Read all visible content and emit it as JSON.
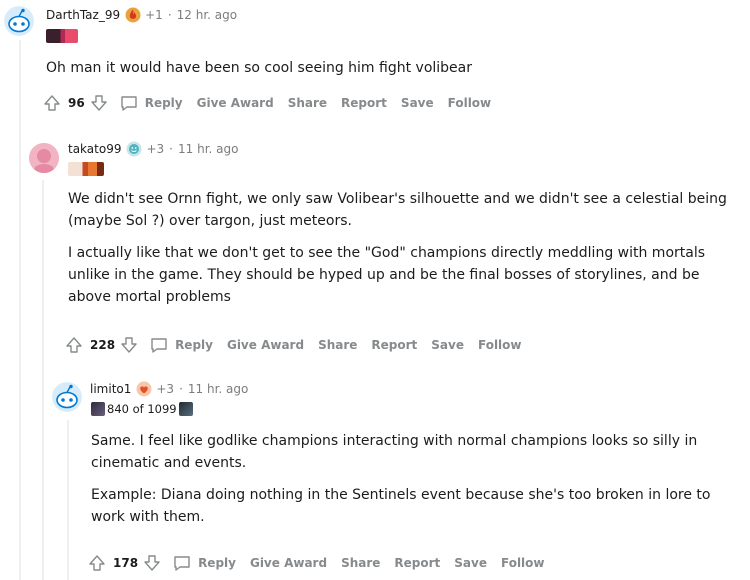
{
  "comments": [
    {
      "username": "DarthTaz_99",
      "points": "+1",
      "separator": "·",
      "time": "12 hr. ago",
      "award_icon": "fire-award-icon",
      "flair_icon": "pentakill-flair-icon",
      "body": [
        "Oh man it would have been so cool seeing him fight volibear"
      ],
      "score": "96",
      "actions": {
        "reply": "Reply",
        "give_award": "Give Award",
        "share": "Share",
        "report": "Report",
        "save": "Save",
        "follow": "Follow"
      }
    },
    {
      "username": "takato99",
      "points": "+3",
      "separator": "·",
      "time": "11 hr. ago",
      "award_icon": "wholesome-award-icon",
      "flair_icon": "flame-flair-icon",
      "body": [
        "We didn't see Ornn fight, we only saw Volibear's silhouette and we didn't see a celestial being (maybe Sol ?) over targon, just meteors.",
        "I actually like that we don't get to see the \"God\" champions directly meddling with mortals unlike in the game. They should be hyped up and be the final bosses of storylines, and be above mortal problems"
      ],
      "score": "228",
      "actions": {
        "reply": "Reply",
        "give_award": "Give Award",
        "share": "Share",
        "report": "Report",
        "save": "Save",
        "follow": "Follow"
      }
    },
    {
      "username": "limito1",
      "points": "+3",
      "separator": "·",
      "time": "11 hr. ago",
      "award_icon": "heart-award-icon",
      "flair_text": "840 of 1099",
      "body": [
        "Same. I feel like godlike champions interacting with normal champions looks so silly in cinematic and events.",
        "Example: Diana doing nothing in the Sentinels event because she's too broken in lore to work with them."
      ],
      "score": "178",
      "actions": {
        "reply": "Reply",
        "give_award": "Give Award",
        "share": "Share",
        "report": "Report",
        "save": "Save",
        "follow": "Follow"
      }
    }
  ],
  "colors": {
    "text": "#1c1c1c",
    "meta": "#7c7c7c",
    "action": "#878a8c",
    "thread_line": "#edeff1",
    "snoo_blue": "#0079d3"
  }
}
